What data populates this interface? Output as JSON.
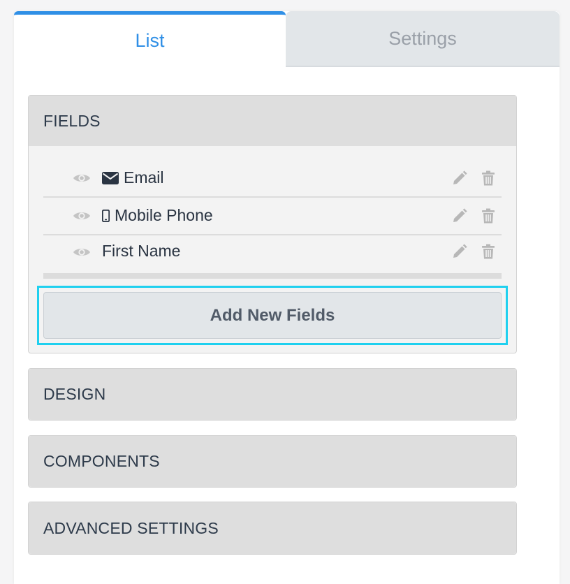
{
  "tabs": {
    "list_label": "List",
    "settings_label": "Settings"
  },
  "fields_section": {
    "title": "FIELDS",
    "items": [
      {
        "label": "Email",
        "icon": "envelope-icon"
      },
      {
        "label": "Mobile Phone",
        "icon": "mobile-phone-icon"
      },
      {
        "label": "First Name",
        "icon": ""
      }
    ],
    "add_button_label": "Add New Fields"
  },
  "sections": {
    "design": "DESIGN",
    "components": "COMPONENTS",
    "advanced": "ADVANCED SETTINGS"
  },
  "colors": {
    "accent": "#2f8fe6",
    "highlight": "#1fd0ef",
    "header_bg": "#dedede"
  }
}
